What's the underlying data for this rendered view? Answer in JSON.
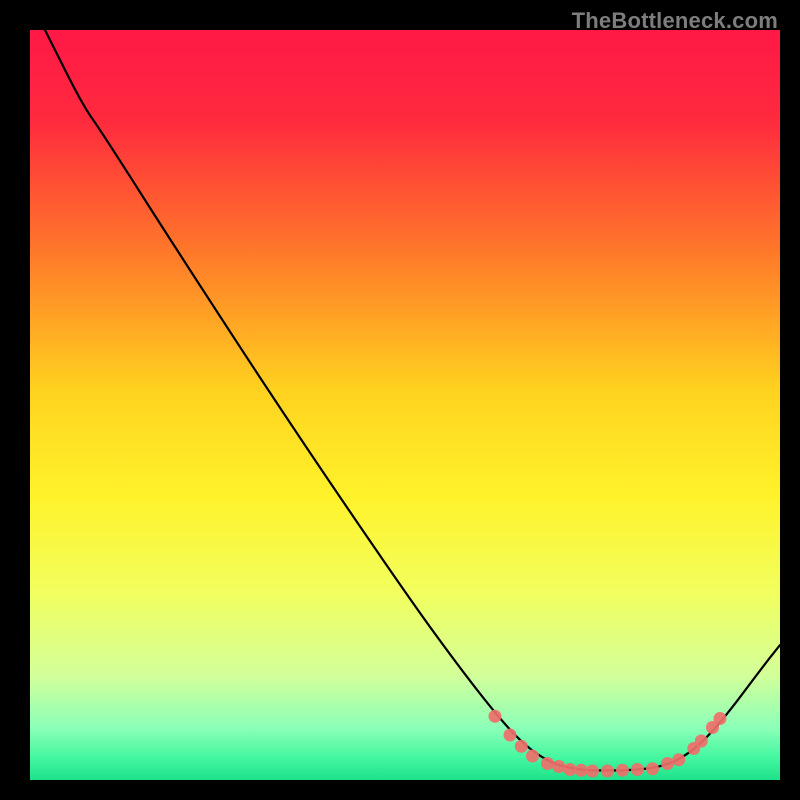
{
  "watermark": "TheBottleneck.com",
  "chart_data": {
    "type": "line",
    "title": "",
    "xlabel": "",
    "ylabel": "",
    "xlim": [
      0,
      100
    ],
    "ylim": [
      0,
      100
    ],
    "gradient_stops": [
      {
        "offset": 0.0,
        "color": "#ff1846"
      },
      {
        "offset": 0.12,
        "color": "#ff2a3e"
      },
      {
        "offset": 0.3,
        "color": "#ff7a29"
      },
      {
        "offset": 0.48,
        "color": "#ffd21f"
      },
      {
        "offset": 0.62,
        "color": "#fff22a"
      },
      {
        "offset": 0.75,
        "color": "#f2ff5e"
      },
      {
        "offset": 0.86,
        "color": "#d3ff99"
      },
      {
        "offset": 0.93,
        "color": "#8cffb8"
      },
      {
        "offset": 0.97,
        "color": "#44f7a0"
      },
      {
        "offset": 1.0,
        "color": "#1de28a"
      }
    ],
    "series": [
      {
        "name": "bottleneck-curve",
        "type": "line",
        "color": "#000000",
        "points": [
          {
            "x": 2.0,
            "y": 100.0
          },
          {
            "x": 7.0,
            "y": 90.0
          },
          {
            "x": 9.5,
            "y": 86.5
          },
          {
            "x": 20.0,
            "y": 70.0
          },
          {
            "x": 35.0,
            "y": 47.0
          },
          {
            "x": 50.0,
            "y": 25.0
          },
          {
            "x": 58.0,
            "y": 14.0
          },
          {
            "x": 64.0,
            "y": 6.5
          },
          {
            "x": 68.0,
            "y": 3.0
          },
          {
            "x": 72.0,
            "y": 1.4
          },
          {
            "x": 78.0,
            "y": 1.2
          },
          {
            "x": 84.0,
            "y": 1.6
          },
          {
            "x": 88.0,
            "y": 3.5
          },
          {
            "x": 92.0,
            "y": 7.5
          },
          {
            "x": 98.0,
            "y": 15.5
          },
          {
            "x": 100.0,
            "y": 18.0
          }
        ]
      },
      {
        "name": "sample-markers",
        "type": "scatter",
        "color": "#ef6f6a",
        "points": [
          {
            "x": 62.0,
            "y": 8.5
          },
          {
            "x": 64.0,
            "y": 6.0
          },
          {
            "x": 65.5,
            "y": 4.5
          },
          {
            "x": 67.0,
            "y": 3.2
          },
          {
            "x": 69.0,
            "y": 2.2
          },
          {
            "x": 70.5,
            "y": 1.8
          },
          {
            "x": 72.0,
            "y": 1.4
          },
          {
            "x": 73.5,
            "y": 1.3
          },
          {
            "x": 75.0,
            "y": 1.2
          },
          {
            "x": 77.0,
            "y": 1.2
          },
          {
            "x": 79.0,
            "y": 1.3
          },
          {
            "x": 81.0,
            "y": 1.4
          },
          {
            "x": 83.0,
            "y": 1.5
          },
          {
            "x": 85.0,
            "y": 2.2
          },
          {
            "x": 86.5,
            "y": 2.7
          },
          {
            "x": 88.5,
            "y": 4.2
          },
          {
            "x": 89.5,
            "y": 5.2
          },
          {
            "x": 91.0,
            "y": 7.0
          },
          {
            "x": 92.0,
            "y": 8.2
          }
        ]
      }
    ]
  }
}
